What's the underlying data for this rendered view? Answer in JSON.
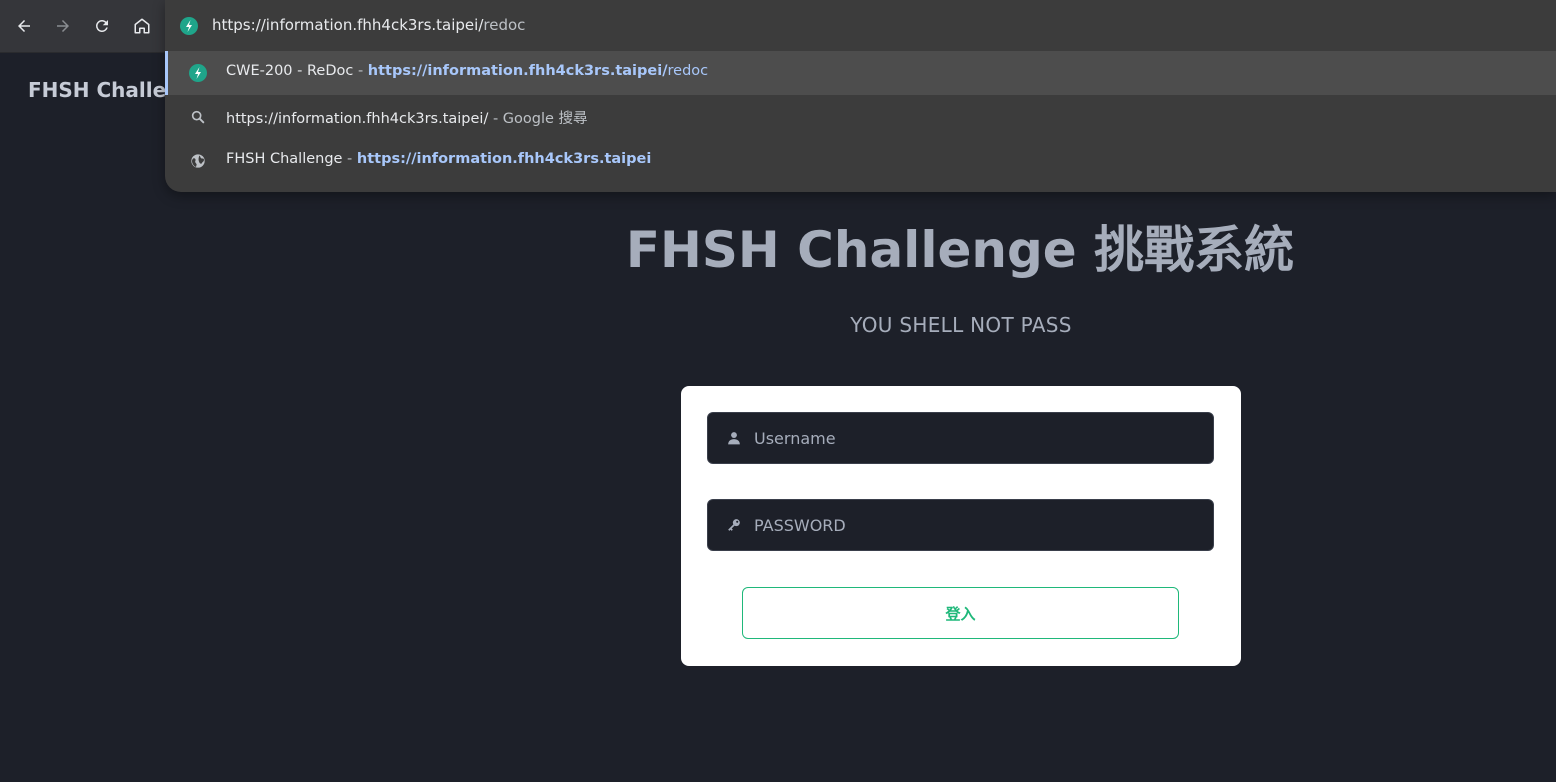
{
  "browser": {
    "nav": {
      "back_icon": "arrow-left-icon",
      "forward_icon": "arrow-right-icon",
      "reload_icon": "reload-icon",
      "home_icon": "home-icon"
    },
    "omnibox": {
      "url_main": "https://information.fhh4ck3rs.taipei/",
      "url_rest": "redoc",
      "favicon_icon": "redoc-favicon-icon",
      "suggestions": [
        {
          "icon": "redoc-favicon-icon",
          "title": "CWE-200 - ReDoc",
          "separator": " - ",
          "url_bold": "https://information.fhh4ck3rs.taipei/",
          "url_rest": "redoc",
          "suffix": ""
        },
        {
          "icon": "search-icon",
          "title": "https://information.fhh4ck3rs.taipei/",
          "separator": " - ",
          "url_bold": "",
          "url_rest": "",
          "suffix": "Google 搜尋"
        },
        {
          "icon": "globe-icon",
          "title": "FHSH Challenge",
          "separator": " - ",
          "url_bold": "https://information.fhh4ck3rs.taipei",
          "url_rest": "",
          "suffix": ""
        }
      ]
    }
  },
  "page": {
    "brand": "FHSH Challen",
    "title": "FHSH Challenge 挑戰系統",
    "subtitle": "YOU SHELL NOT PASS",
    "form": {
      "username_placeholder": "Username",
      "password_placeholder": "PASSWORD",
      "login_label": "登入",
      "username_icon": "user-icon",
      "password_icon": "key-icon"
    }
  },
  "colors": {
    "page_bg": "#1d2029",
    "accent": "#1fb87a",
    "link": "#a8c7fa",
    "text_muted": "#a6adbb"
  }
}
